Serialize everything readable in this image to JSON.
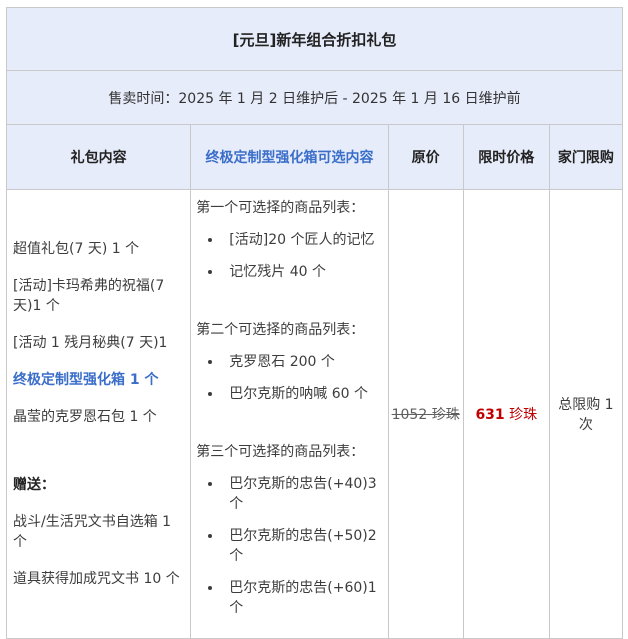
{
  "title": "[元旦]新年组合折扣礼包",
  "sale_time": "售卖时间：2025 年 1 月 2 日维护后 - 2025 年 1 月 16 日维护前",
  "columns": {
    "package_content": "礼包内容",
    "box_options": "终极定制型强化箱可选内容",
    "original_price": "原价",
    "limited_price": "限时价格",
    "family_limit": "家门限购"
  },
  "package": {
    "items": [
      "超值礼包(7 天) 1 个",
      "[活动]卡玛希弗的祝福(7 天)1 个",
      "[活动 1 残月秘典(7 天)1"
    ],
    "highlight_item": "终极定制型强化箱 1 个",
    "item_after_highlight": "晶莹的克罗恩石包 1 个",
    "gift_label": "赠送：",
    "gift_items": [
      "战斗/生活咒文书自选箱 1 个",
      "道具获得加成咒文书 10 个"
    ]
  },
  "box_options": {
    "groups": [
      {
        "title": "第一个可选择的商品列表：",
        "items": [
          "[活动]20 个匠人的记忆",
          "记忆残片 40 个"
        ]
      },
      {
        "title": "第二个可选择的商品列表：",
        "items": [
          "克罗恩石 200 个",
          "巴尔克斯的呐喊 60 个"
        ]
      },
      {
        "title": "第三个可选择的商品列表：",
        "items": [
          "巴尔克斯的忠告(+40)3 个",
          "巴尔克斯的忠告(+50)2 个",
          "巴尔克斯的忠告(+60)1 个"
        ]
      }
    ]
  },
  "pricing": {
    "original_price": "1052 珍珠",
    "limited_price_value": "631",
    "limited_price_unit": "珍珠",
    "purchase_limit": "总限购 1 次"
  },
  "colors": {
    "header_bg": "#e7ecfa",
    "link_blue": "#3a6ec9",
    "price_red": "#c00000",
    "border_gray": "#c9c9c9",
    "strike_gray": "#5f5f5f"
  }
}
